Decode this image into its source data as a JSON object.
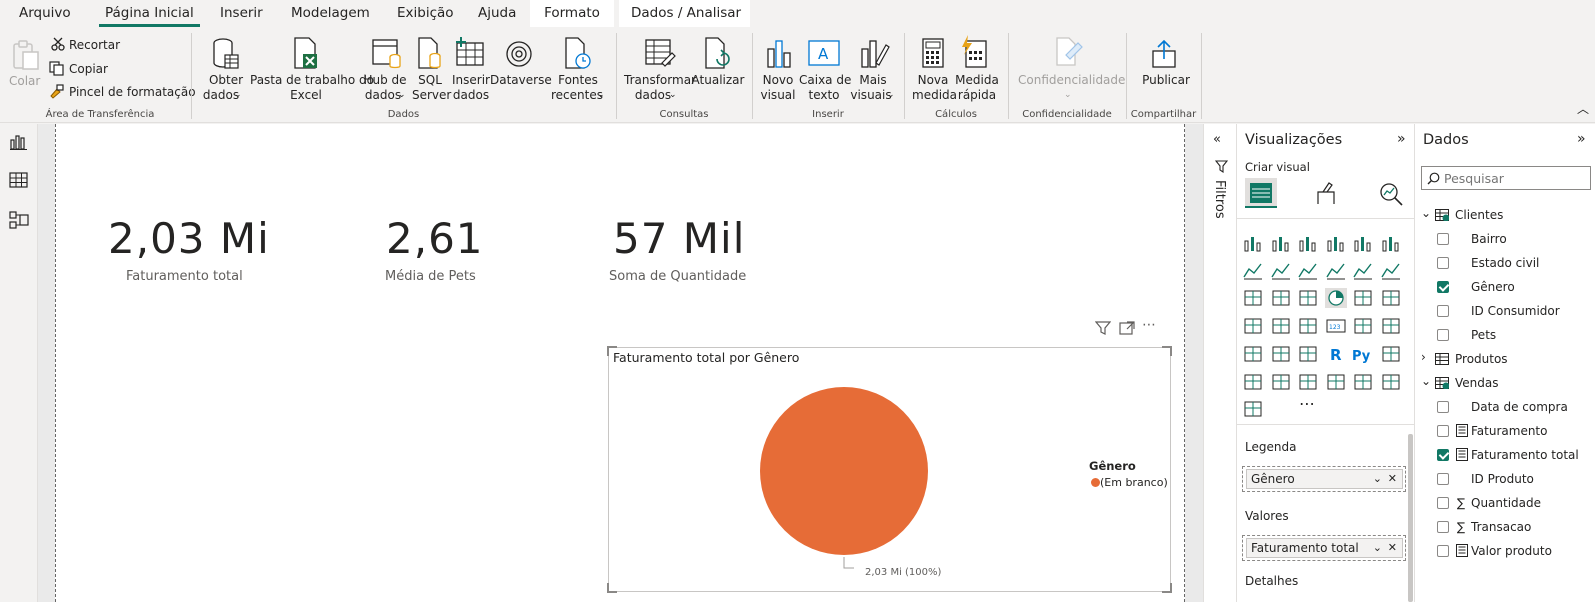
{
  "menu": {
    "tabs": [
      "Arquivo",
      "Página Inicial",
      "Inserir",
      "Modelagem",
      "Exibição",
      "Ajuda",
      "Formato",
      "Dados / Analisar"
    ]
  },
  "ribbon": {
    "clipboard": {
      "paste": "Colar",
      "cut": "Recortar",
      "copy": "Copiar",
      "format_painter": "Pincel de formatação",
      "group": "Área de Transferência"
    },
    "data": {
      "get_data_1": "Obter",
      "get_data_2": "dados",
      "excel_1": "Pasta de trabalho do",
      "excel_2": "Excel",
      "hub_1": "Hub de",
      "hub_2": "dados",
      "sql_1": "SQL",
      "sql_2": "Server",
      "insert_1": "Inserir",
      "insert_2": "dados",
      "dataverse": "Dataverse",
      "recent_1": "Fontes",
      "recent_2": "recentes",
      "group": "Dados"
    },
    "queries": {
      "transform_1": "Transformar",
      "transform_2": "dados",
      "refresh": "Atualizar",
      "group": "Consultas"
    },
    "insert": {
      "new_visual_1": "Novo",
      "new_visual_2": "visual",
      "textbox_1": "Caixa de",
      "textbox_2": "texto",
      "more_1": "Mais",
      "more_2": "visuais",
      "group": "Inserir"
    },
    "calc": {
      "new_measure_1": "Nova",
      "new_measure_2": "medida",
      "quick_1": "Medida",
      "quick_2": "rápida",
      "group": "Cálculos"
    },
    "sensitivity": {
      "label": "Confidencialidade",
      "group": "Confidencialidade"
    },
    "share": {
      "publish": "Publicar",
      "group": "Compartilhar"
    }
  },
  "cards": [
    {
      "value": "2,03 Mi",
      "label": "Faturamento total"
    },
    {
      "value": "2,61",
      "label": "Média de Pets"
    },
    {
      "value": "57 Mil",
      "label": "Soma de Quantidade"
    }
  ],
  "pie": {
    "title": "Faturamento total por Gênero",
    "legend_title": "Gênero",
    "legend_item": "(Em branco)",
    "data_label": "2,03 Mi (100%)",
    "color": "#e66c37"
  },
  "chart_data": {
    "type": "pie",
    "title": "Faturamento total por Gênero",
    "categories": [
      "(Em branco)"
    ],
    "values": [
      2030000
    ],
    "percent": [
      100
    ],
    "legend_title": "Gênero",
    "legend_placement": "right"
  },
  "filters": {
    "label": "Filtros"
  },
  "viz": {
    "title": "Visualizações",
    "build": "Criar visual",
    "legend_well": "Legenda",
    "legend_field": "Gênero",
    "values_well": "Valores",
    "values_field": "Faturamento total",
    "details_well": "Detalhes",
    "more": "⋯"
  },
  "data_pane": {
    "title": "Dados",
    "search_placeholder": "Pesquisar",
    "tables": [
      {
        "name": "Clientes",
        "fields": [
          {
            "name": "Bairro",
            "checked": false
          },
          {
            "name": "Estado civil",
            "checked": false
          },
          {
            "name": "Gênero",
            "checked": true
          },
          {
            "name": "ID Consumidor",
            "checked": false
          },
          {
            "name": "Pets",
            "checked": false
          }
        ]
      },
      {
        "name": "Produtos"
      },
      {
        "name": "Vendas",
        "fields": [
          {
            "name": "Data de compra",
            "checked": false
          },
          {
            "name": "Faturamento",
            "checked": false
          },
          {
            "name": "Faturamento total",
            "checked": true
          },
          {
            "name": "ID Produto",
            "checked": false
          },
          {
            "name": "Quantidade",
            "checked": false
          },
          {
            "name": "Transacao",
            "checked": false
          },
          {
            "name": "Valor produto",
            "checked": false
          }
        ]
      }
    ]
  },
  "colors": {
    "accent": "#117865",
    "pie": "#e66c37"
  }
}
